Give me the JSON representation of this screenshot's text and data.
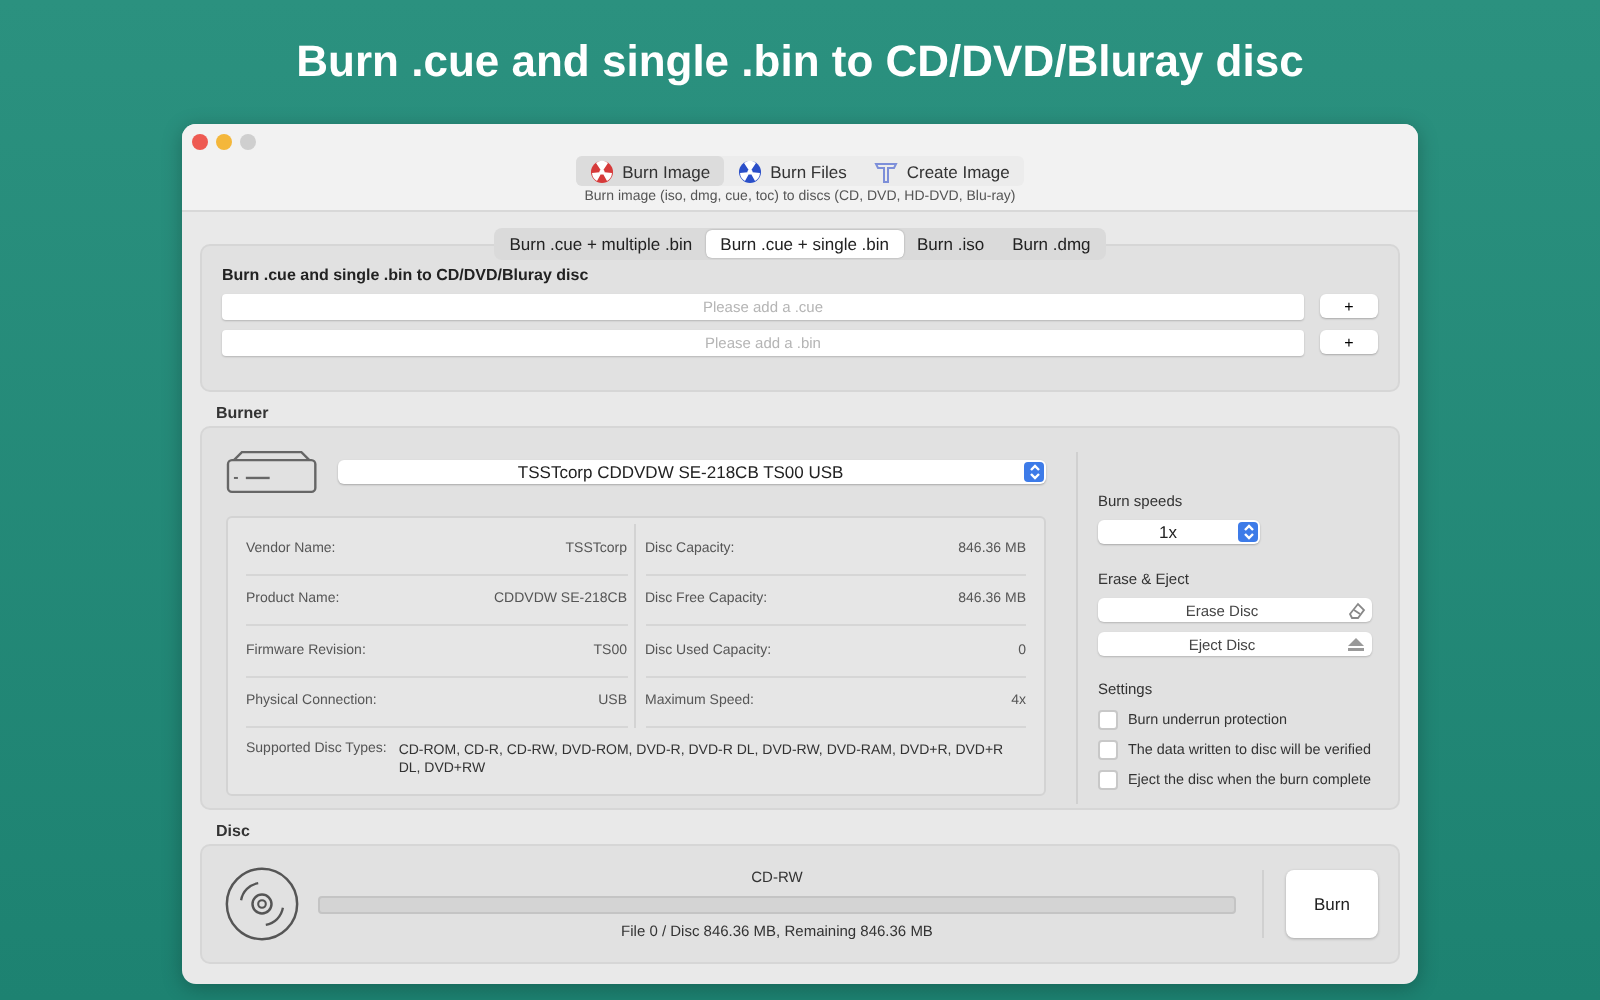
{
  "headline": "Burn .cue and single .bin to CD/DVD/Bluray disc",
  "toolbar": [
    {
      "label": "Burn Image",
      "kind": "burn",
      "selected": true
    },
    {
      "label": "Burn Files",
      "kind": "files",
      "selected": false
    },
    {
      "label": "Create Image",
      "kind": "create",
      "selected": false
    }
  ],
  "toolbar_caption": "Burn image (iso, dmg, cue, toc) to discs (CD, DVD, HD-DVD, Blu-ray)",
  "tabs": [
    {
      "label": "Burn .cue + multiple .bin",
      "selected": false
    },
    {
      "label": "Burn .cue + single .bin",
      "selected": true
    },
    {
      "label": "Burn .iso",
      "selected": false
    },
    {
      "label": "Burn .dmg",
      "selected": false
    }
  ],
  "source": {
    "title": "Burn .cue and single .bin to CD/DVD/Bluray disc",
    "fields": [
      {
        "placeholder": "Please add a .cue",
        "button": "+"
      },
      {
        "placeholder": "Please add a .bin",
        "button": "+"
      }
    ]
  },
  "burner": {
    "label": "Burner",
    "device": "TSSTcorp CDDVDW SE-218CB TS00 USB",
    "info_left": [
      {
        "name": "Vendor Name:",
        "value": "TSSTcorp"
      },
      {
        "name": "Product Name:",
        "value": "CDDVDW SE-218CB"
      },
      {
        "name": "Firmware Revision:",
        "value": "TS00"
      },
      {
        "name": "Physical Connection:",
        "value": "USB"
      }
    ],
    "info_right": [
      {
        "name": "Disc Capacity:",
        "value": "846.36 MB"
      },
      {
        "name": "Disc Free Capacity:",
        "value": "846.36 MB"
      },
      {
        "name": "Disc Used Capacity:",
        "value": "0"
      },
      {
        "name": "Maximum Speed:",
        "value": "4x"
      }
    ],
    "supported": {
      "name": "Supported Disc Types:",
      "value": "CD-ROM, CD-R, CD-RW, DVD-ROM, DVD-R, DVD-R DL, DVD-RW, DVD-RAM, DVD+R, DVD+R DL, DVD+RW"
    },
    "speeds": {
      "label": "Burn speeds",
      "value": "1x"
    },
    "erase_eject": {
      "label": "Erase & Eject",
      "buttons": [
        {
          "label": "Erase Disc",
          "kind": "erase"
        },
        {
          "label": "Eject Disc",
          "kind": "eject"
        }
      ]
    },
    "settings": {
      "label": "Settings",
      "options": [
        {
          "label": "Burn underrun protection",
          "checked": false
        },
        {
          "label": "The data written to disc will be verified",
          "checked": false
        },
        {
          "label": "Eject the disc when the burn complete",
          "checked": false
        }
      ]
    }
  },
  "disc": {
    "label": "Disc",
    "type": "CD-RW",
    "level": 0,
    "status": "File 0 / Disc 846.36 MB, Remaining 846.36 MB",
    "button": "Burn"
  }
}
